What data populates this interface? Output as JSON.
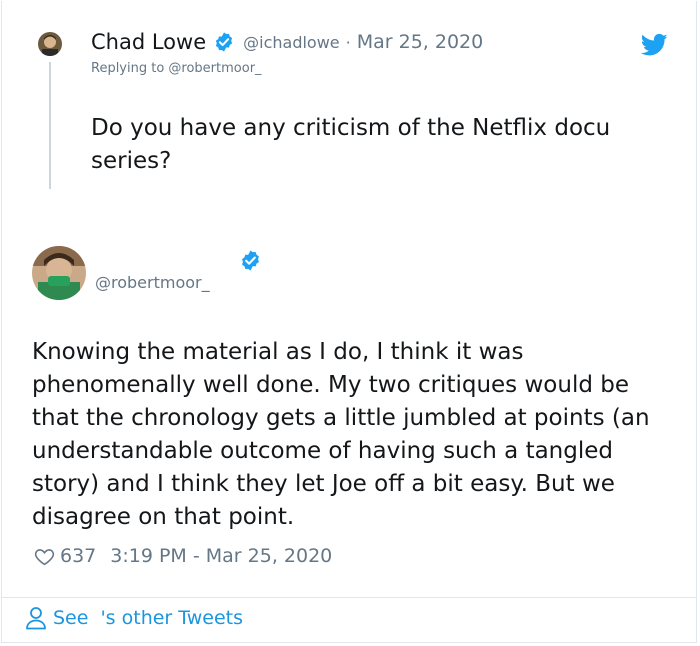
{
  "parent": {
    "name": "Chad Lowe",
    "handle": "@ichadlowe",
    "separator": "·",
    "date": "Mar 25, 2020",
    "replying_to": "Replying to @robertmoor_",
    "text": "Do you have any criticism of the Netflix docu series?"
  },
  "main": {
    "handle": "@robertmoor_",
    "text": "Knowing the material as I do, I think it was phenomenally well done. My two critiques would be that the chronology gets a little jumbled at points (an understandable outcome of having such a tangled story) and I think they let Joe off a bit easy. But we disagree on that point.",
    "likes": "637",
    "timestamp": "3:19 PM - Mar 25, 2020"
  },
  "footer": {
    "see_label": "See",
    "other_tweets_label": "'s other Tweets"
  },
  "icons": {
    "verified": "verified-badge-icon",
    "twitter": "twitter-bird-icon",
    "heart": "heart-icon",
    "person": "person-icon"
  },
  "colors": {
    "twitter_blue": "#1da1f2",
    "link_blue": "#1b95e0",
    "secondary_text": "#657786",
    "border": "#e1e8ed"
  }
}
